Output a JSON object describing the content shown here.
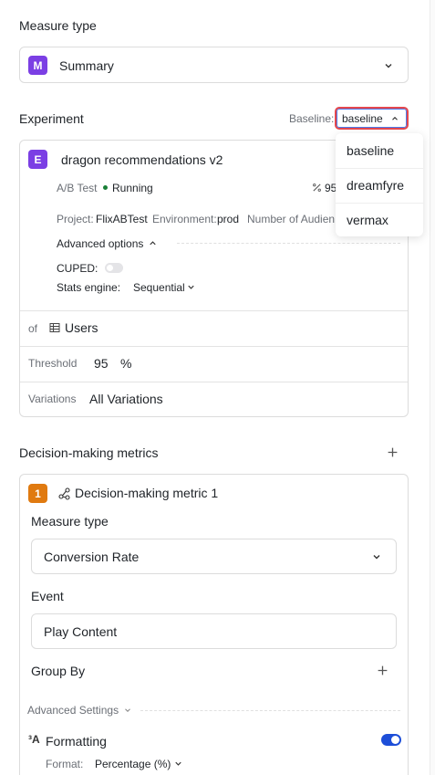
{
  "measure_type": {
    "title": "Measure type",
    "badge": "M",
    "value": "Summary",
    "chevron": "chevron-down-icon"
  },
  "experiment": {
    "title": "Experiment",
    "baseline_label": "Baseline:",
    "baseline_value": "baseline",
    "card": {
      "badge": "E",
      "name": "dragon recommendations v2",
      "test_type": "A/B Test",
      "status": "Running",
      "status_color": "#1a7f37",
      "traffic": "95",
      "project_label": "Project:",
      "project_value": "FlixABTest",
      "environment_label": "Environment:",
      "environment_value": "prod",
      "audience_label": "Number of Audienc",
      "advanced_options": "Advanced options",
      "cuped_label": "CUPED:",
      "stats_engine_label": "Stats engine:",
      "stats_engine_value": "Sequential"
    },
    "of_label": "of",
    "of_value": "Users",
    "threshold_label": "Threshold",
    "threshold_value": "95",
    "threshold_unit": "%",
    "variations_label": "Variations",
    "variations_value": "All Variations"
  },
  "baseline_dropdown": {
    "options": [
      "baseline",
      "dreamfyre",
      "vermax"
    ]
  },
  "decision_metrics": {
    "title": "Decision-making metrics",
    "metric": {
      "badge": "1",
      "name": "Decision-making metric 1",
      "measure_type_label": "Measure type",
      "measure_type_value": "Conversion Rate",
      "event_label": "Event",
      "event_value": "Play Content",
      "group_by_label": "Group By",
      "advanced_settings": "Advanced Settings",
      "formatting_label": "Formatting",
      "formatting_enabled": true,
      "format_label": "Format:",
      "format_value": "Percentage (%)"
    }
  },
  "colors": {
    "accent": "#7b3fe4",
    "metric_badge": "#e07a10",
    "toggle_on": "#1d4ed8",
    "focus_ring": "#e5484d"
  }
}
